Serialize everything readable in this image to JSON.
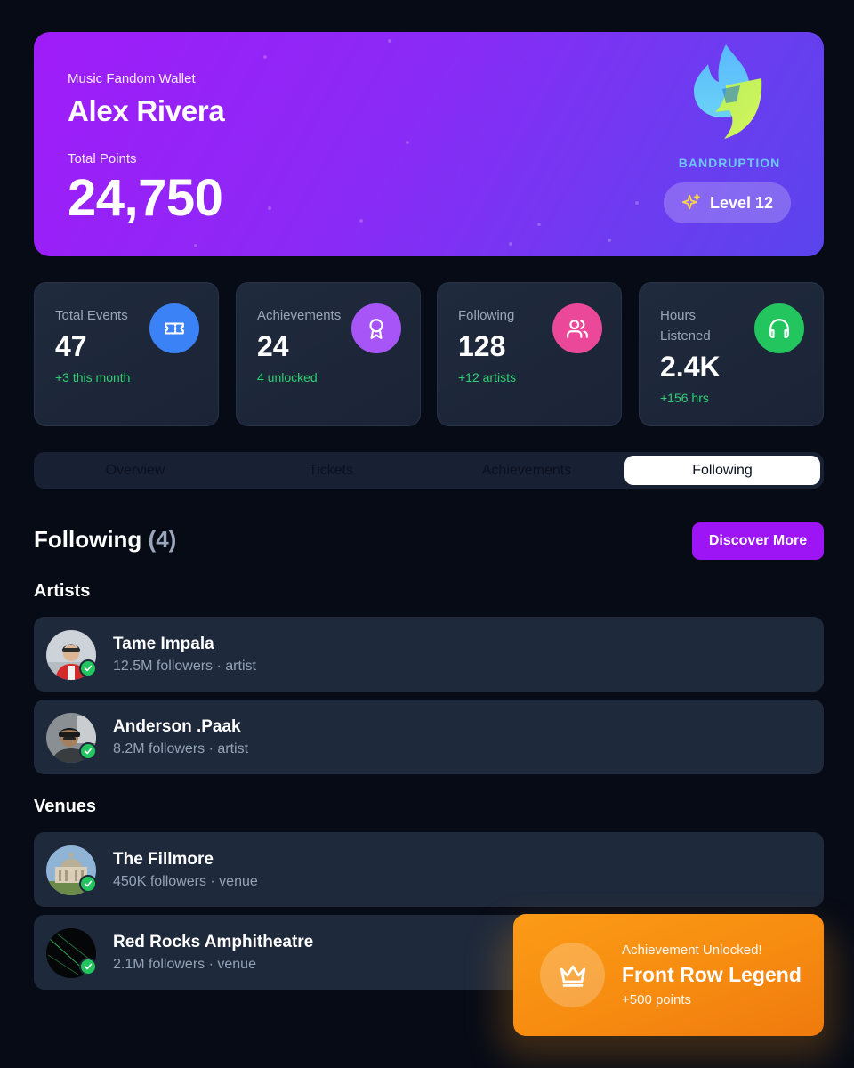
{
  "hero": {
    "subtitle": "Music Fandom Wallet",
    "name": "Alex Rivera",
    "points_label": "Total Points",
    "points": "24,750",
    "brand": "BANDRUPTION",
    "level": "Level 12"
  },
  "stats": [
    {
      "label": "Total Events",
      "value": "47",
      "delta": "+3 this month",
      "icon": "ticket-icon",
      "color": "#3b82f6"
    },
    {
      "label": "Achievements",
      "value": "24",
      "delta": "4 unlocked",
      "icon": "award-icon",
      "color": "#a855f7"
    },
    {
      "label": "Following",
      "value": "128",
      "delta": "+12 artists",
      "icon": "users-icon",
      "color": "#ec4899"
    },
    {
      "label": "Hours Listened",
      "value": "2.4K",
      "delta": "+156 hrs",
      "icon": "headphones-icon",
      "color": "#22c55e"
    }
  ],
  "tabs": [
    "Overview",
    "Tickets",
    "Achievements",
    "Following"
  ],
  "active_tab": "Following",
  "following": {
    "title": "Following",
    "count": "(4)",
    "discover_label": "Discover More",
    "artists_label": "Artists",
    "venues_label": "Venues",
    "artists": [
      {
        "name": "Tame Impala",
        "meta": "12.5M followers · artist"
      },
      {
        "name": "Anderson .Paak",
        "meta": "8.2M followers · artist"
      }
    ],
    "venues": [
      {
        "name": "The Fillmore",
        "meta": "450K followers · venue"
      },
      {
        "name": "Red Rocks Amphitheatre",
        "meta": "2.1M followers · venue"
      }
    ]
  },
  "toast": {
    "heading": "Achievement Unlocked!",
    "title": "Front Row Legend",
    "points": "+500 points"
  },
  "colors": {
    "background": "#070b16",
    "card": "#1e293b",
    "accent_purple": "#9d14f5",
    "success_green": "#2fd072",
    "toast_orange": "#f68a10"
  }
}
